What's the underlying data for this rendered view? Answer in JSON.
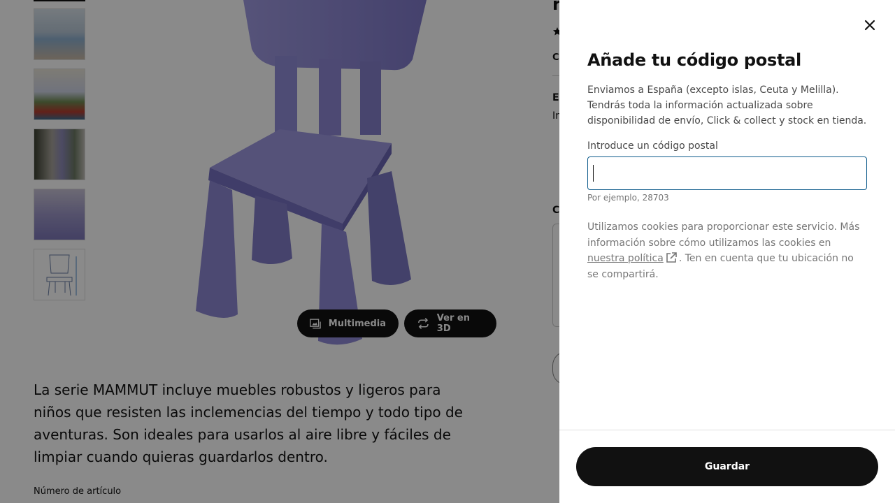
{
  "product": {
    "description": "La serie MAMMUT incluye muebles robustos y ligeros para niños que resisten las inclemencias del tiempo y todo tipo de aventuras. Son ideales para usarlos al aire libre y fáciles de limpiar cuando quieras guardarlos dentro.",
    "article_number_label": "Número de artículo",
    "chair_color": "#8f8ad6"
  },
  "media_buttons": {
    "multimedia": "Multimedia",
    "view_3d": "Ver en 3D"
  },
  "right_column_fragments": {
    "top": "r",
    "co": "Co",
    "el": "El",
    "in": "In",
    "c": "C"
  },
  "modal": {
    "title": "Añade tu código postal",
    "intro": "Enviamos a España (excepto islas, Ceuta y Melilla). Tendrás toda la información actualizada sobre disponibilidad de envío, Click & collect y stock en tienda.",
    "field_label": "Introduce un código postal",
    "field_value": "",
    "field_hint": "Por ejemplo, 28703",
    "cookie_text_before": "Utilizamos cookies para proporcionar este servicio. Más información sobre cómo utilizamos las cookies en",
    "cookie_link": "nuestra política",
    "cookie_text_after": ". Ten en cuenta que tu ubicación no se compartirá.",
    "save_label": "Guardar",
    "close_icon": "close-icon"
  },
  "colors": {
    "primary_button": "#111111",
    "input_border": "#0e5c8c",
    "overlay": "rgba(0,0,0,0.46)"
  }
}
